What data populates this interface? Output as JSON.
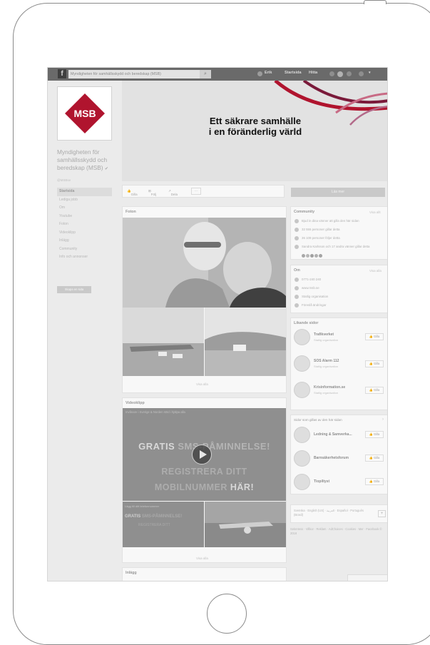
{
  "topbar": {
    "search_placeholder": "Myndigheten för samhällsskydd och beredskap (MSB)",
    "user_name": "Erik",
    "home": "Startsida",
    "find": "Hitta"
  },
  "page": {
    "logo_text": "MSB",
    "name": "Myndigheten för samhällsskydd och beredskap (MSB)",
    "handle": "@MSBse",
    "nav": [
      "Startsida",
      "Lediga jobb",
      "Om",
      "Youtube",
      "Foton",
      "Videoklipp",
      "Inlägg",
      "Community",
      "Info och annonser"
    ],
    "create_page": "Skapa en sida",
    "cover_line1": "Ett säkrare samhälle",
    "cover_line2": "i en föränderlig värld",
    "actions": {
      "like": "Gilla",
      "follow": "Följ",
      "share": "Dela",
      "more": "···"
    },
    "primary_button": "Läs mer"
  },
  "photos": {
    "title": "Foton",
    "see_all": "Visa alla"
  },
  "videos": {
    "title": "Videoklipp",
    "caption": "Invånare i Sverige & Norden stöd i hjälpa alla",
    "line1a": "GRATIS",
    "line1b": "SMS-PÅMINNELSE!",
    "line2": "REGISTRERA DITT",
    "line3a": "MOBILNUMMER",
    "line3b": "HÄR!",
    "small_caption": "Lägg till ditt telefonnummer",
    "see_all": "Visa alla"
  },
  "posts": {
    "title": "Inlägg"
  },
  "community": {
    "title": "Community",
    "see_all": "Visa allt",
    "rows": [
      "Bjud in dina vänner att gilla den här sidan",
      "32 555 personer gillar detta",
      "36 109 personer följer detta",
      "Sandra Karlsson och 17 andra vänner gillar detta"
    ]
  },
  "about": {
    "title": "Om",
    "see_all": "Visa alla",
    "rows": [
      "0771-240 240",
      "www.msb.se",
      "Statlig organisation",
      "Föreslå ändringar"
    ]
  },
  "liked": {
    "title": "Likande sidor",
    "pages": [
      {
        "name": "Trafikverket",
        "type": "Statlig organisation"
      },
      {
        "name": "SOS Alarm 112",
        "type": "Statlig organisation"
      },
      {
        "name": "Krisinformation.se",
        "type": "Statlig organisation"
      }
    ],
    "like_label": "Gilla"
  },
  "suggested": {
    "title": "Sidor som gillas av den här sidan",
    "pages": [
      "Ledning & Samverka...",
      "Barnsäkerhetsforum",
      "Tiopiltyst"
    ],
    "like_label": "Gilla"
  },
  "languages": "Svenska · English (US) · العربية · Español · Português (Brasil)",
  "footer": "Sekretess · Villkor · Reklam · AdChoices · Cookies · Mer · Facebook © 2018"
}
